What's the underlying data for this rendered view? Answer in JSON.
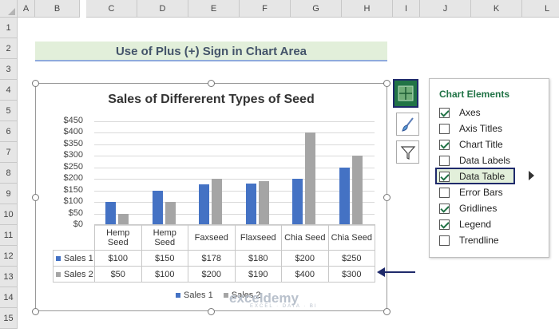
{
  "columns": [
    "A",
    "B",
    "C",
    "D",
    "E",
    "F",
    "G",
    "H",
    "I",
    "J",
    "K",
    "L"
  ],
  "rows": [
    "1",
    "2",
    "3",
    "4",
    "5",
    "6",
    "7",
    "8",
    "9",
    "10",
    "11",
    "12",
    "13",
    "14",
    "15"
  ],
  "banner_title": "Use of Plus (+) Sign in Chart Area",
  "chart_data": {
    "type": "bar",
    "title": "Sales of Differerent Types of Seed",
    "categories": [
      "Hemp Seed",
      "Hemp Seed",
      "Faxseed",
      "Flaxseed",
      "Chia Seed",
      "Chia Seed"
    ],
    "category_lines": [
      [
        "Hemp",
        "Seed"
      ],
      [
        "Hemp",
        "Seed"
      ],
      [
        "Faxseed"
      ],
      [
        "Flaxseed"
      ],
      [
        "Chia Seed"
      ],
      [
        "Chia Seed"
      ]
    ],
    "series": [
      {
        "name": "Sales 1",
        "values": [
          100,
          150,
          178,
          180,
          200,
          250
        ],
        "labels": [
          "$100",
          "$150",
          "$178",
          "$180",
          "$200",
          "$250"
        ],
        "color": "#4472c4"
      },
      {
        "name": "Sales 2",
        "values": [
          50,
          100,
          200,
          190,
          400,
          300
        ],
        "labels": [
          "$50",
          "$100",
          "$200",
          "$190",
          "$400",
          "$300"
        ],
        "color": "#a5a5a5"
      }
    ],
    "yticks": [
      "$450",
      "$400",
      "$350",
      "$300",
      "$250",
      "$200",
      "$150",
      "$100",
      "$50",
      "$0"
    ],
    "ylim": [
      0,
      450
    ],
    "grid": true,
    "legend": "bottom",
    "data_table": true
  },
  "chart_elements": {
    "title": "Chart Elements",
    "items": [
      {
        "label": "Axes",
        "checked": true
      },
      {
        "label": "Axis Titles",
        "checked": false
      },
      {
        "label": "Chart Title",
        "checked": true
      },
      {
        "label": "Data Labels",
        "checked": false
      },
      {
        "label": "Data Table",
        "checked": true
      },
      {
        "label": "Error Bars",
        "checked": false
      },
      {
        "label": "Gridlines",
        "checked": true
      },
      {
        "label": "Legend",
        "checked": true
      },
      {
        "label": "Trendline",
        "checked": false
      }
    ]
  },
  "side_buttons": [
    "plus-icon",
    "brush-icon",
    "filter-icon"
  ],
  "watermark": {
    "name": "exceldemy",
    "tagline": "EXCEL · DATA · BI"
  },
  "colors": {
    "accent": "#217346",
    "highlight_border": "#1f2a6b",
    "banner_bg": "#e2efda"
  }
}
